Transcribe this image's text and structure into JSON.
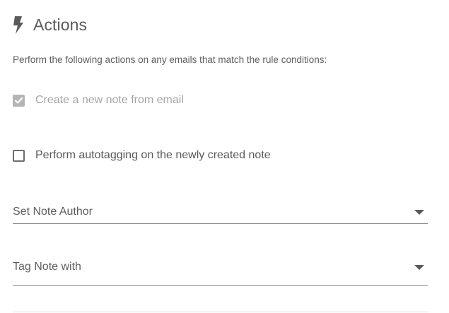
{
  "section": {
    "title": "Actions",
    "icon": "bolt-icon",
    "description": "Perform the following actions on any emails that match the rule conditions:"
  },
  "actions": {
    "create_note": {
      "label": "Create a new note from email",
      "checked": true,
      "disabled": true
    },
    "autotag": {
      "label": "Perform autotagging on the newly created note",
      "checked": false,
      "disabled": false
    }
  },
  "fields": {
    "note_author": {
      "label": "Set Note Author",
      "icon": "caret-down-icon"
    },
    "tag_note": {
      "label": "Tag Note with",
      "icon": "caret-down-icon"
    }
  },
  "colors": {
    "text": "#555555",
    "disabled_text": "#a5a5a5",
    "disabled_checkbox": "#b5b5b5",
    "underline": "#8a8a8a"
  }
}
